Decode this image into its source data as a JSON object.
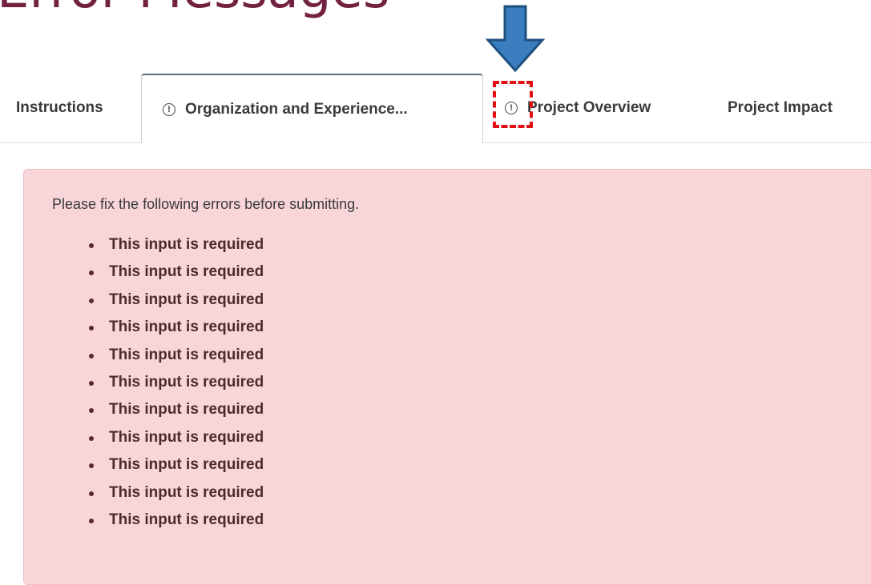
{
  "slide": {
    "title": "Error Messages"
  },
  "tabs": [
    {
      "label": "Instructions",
      "has_error_icon": false,
      "active": false
    },
    {
      "label": "Organization and Experience...",
      "has_error_icon": true,
      "active": true
    },
    {
      "label": "Project Overview",
      "has_error_icon": true,
      "active": false
    },
    {
      "label": "Project Impact",
      "has_error_icon": false,
      "active": false
    }
  ],
  "tab_icon_glyph": "!",
  "error_panel": {
    "intro": "Please fix the following errors before submitting.",
    "items": [
      "This input is required",
      "This input is required",
      "This input is required",
      "This input is required",
      "This input is required",
      "This input is required",
      "This input is required",
      "This input is required",
      "This input is required",
      "This input is required",
      "This input is required"
    ]
  },
  "colors": {
    "title": "#722140",
    "arrow_fill": "#3a7ebf",
    "arrow_stroke": "#1f4f7e",
    "highlight_box": "#e20f12",
    "error_background": "#f7d5d9",
    "active_tab_top_border": "#5a6f84"
  }
}
